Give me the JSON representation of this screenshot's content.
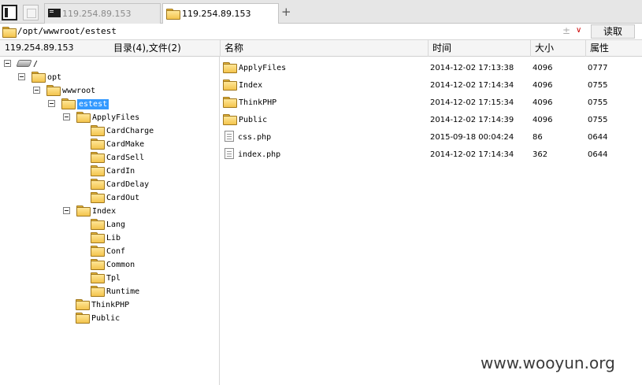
{
  "tabs": [
    {
      "label": "119.254.89.153",
      "active": false
    },
    {
      "label": "119.254.89.153",
      "active": true
    }
  ],
  "new_tab_label": "+",
  "path": {
    "value": "/opt/wwwroot/estest",
    "plus_minus": "±",
    "dropdown": "∨",
    "go_label": "读取"
  },
  "header": {
    "host": "119.254.89.153",
    "count": "目录(4),文件(2)"
  },
  "columns": {
    "name": "名称",
    "time": "时间",
    "size": "大小",
    "attr": "属性"
  },
  "tree": {
    "root": "/",
    "opt": "opt",
    "wwwroot": "wwwroot",
    "estest": "estest",
    "applyfiles": "ApplyFiles",
    "applyfiles_children": [
      "CardCharge",
      "CardMake",
      "CardSell",
      "CardIn",
      "CardDelay",
      "CardOut"
    ],
    "index": "Index",
    "index_children": [
      "Lang",
      "Lib",
      "Conf",
      "Common",
      "Tpl",
      "Runtime"
    ],
    "thinkphp": "ThinkPHP",
    "public": "Public"
  },
  "files": [
    {
      "name": "ApplyFiles",
      "type": "folder",
      "time": "2014-12-02 17:13:38",
      "size": "4096",
      "attr": "0777"
    },
    {
      "name": "Index",
      "type": "folder",
      "time": "2014-12-02 17:14:34",
      "size": "4096",
      "attr": "0755"
    },
    {
      "name": "ThinkPHP",
      "type": "folder",
      "time": "2014-12-02 17:15:34",
      "size": "4096",
      "attr": "0755"
    },
    {
      "name": "Public",
      "type": "folder",
      "time": "2014-12-02 17:14:39",
      "size": "4096",
      "attr": "0755"
    },
    {
      "name": "css.php",
      "type": "file",
      "time": "2015-09-18 00:04:24",
      "size": "86",
      "attr": "0644"
    },
    {
      "name": "index.php",
      "type": "file",
      "time": "2014-12-02 17:14:34",
      "size": "362",
      "attr": "0644"
    }
  ],
  "watermark": "www.wooyun.org"
}
